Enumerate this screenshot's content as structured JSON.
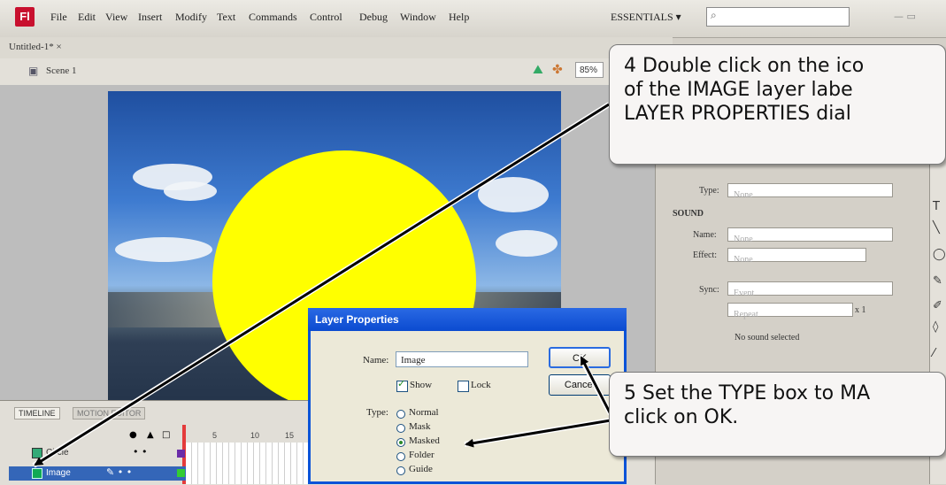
{
  "menubar": {
    "logo": "Fl",
    "items": [
      "File",
      "Edit",
      "View",
      "Insert",
      "Modify",
      "Text",
      "Commands",
      "Control",
      "Debug",
      "Window",
      "Help"
    ],
    "workspace": "ESSENTIALS ▾",
    "search_icon": "search-icon"
  },
  "document": {
    "tab": "Untitled-1* ×",
    "scene": "Scene 1",
    "zoom": "85%"
  },
  "panel": {
    "type_label": "Type:",
    "type_value": "None",
    "sound_header": "SOUND",
    "name_label": "Name:",
    "name_value": "None",
    "effect_label": "Effect:",
    "effect_value": "None",
    "sync_label": "Sync:",
    "sync_value": "Event",
    "repeat_value": "Repeat",
    "repeat_count": "x 1",
    "no_sound": "No sound selected"
  },
  "timeline": {
    "tab1": "TIMELINE",
    "tab2": "MOTION EDITOR",
    "frame_numbers": [
      "5",
      "10",
      "15"
    ],
    "layer1": "Circle",
    "layer2": "Image"
  },
  "dialog": {
    "title": "Layer Properties",
    "name_label": "Name:",
    "name_value": "Image",
    "ok": "OK",
    "cancel": "Cancel",
    "show": "Show",
    "lock": "Lock",
    "type_label": "Type:",
    "types": [
      "Normal",
      "Mask",
      "Masked",
      "Folder",
      "Guide"
    ],
    "selected_type": "Masked"
  },
  "callouts": {
    "step4_line1": "4  Double click on the ico",
    "step4_line2": "    of the IMAGE layer labe",
    "step4_line3": "    LAYER PROPERTIES dial",
    "step5_line1": "5  Set the TYPE box to MA",
    "step5_line2": "    click on OK."
  },
  "colors": {
    "circle": "#ffff00",
    "dialog_title": "#0b4bd0",
    "arrow": "#000000"
  }
}
